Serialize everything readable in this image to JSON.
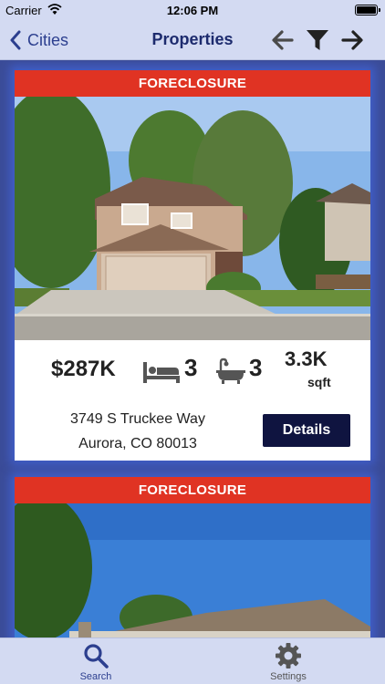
{
  "status_bar": {
    "carrier": "Carrier",
    "time": "12:06 PM"
  },
  "nav": {
    "back_label": "Cities",
    "title": "Properties",
    "icons": [
      "arrow-left-icon",
      "filter-icon",
      "arrow-right-icon"
    ]
  },
  "listings": [
    {
      "banner": "FORECLOSURE",
      "price": "$287K",
      "beds": "3",
      "baths": "3",
      "sqft": "3.3K",
      "sqft_unit": "sqft",
      "address_line1": "3749 S Truckee Way",
      "address_line2": "Aurora, CO 80013",
      "details_label": "Details"
    },
    {
      "banner": "FORECLOSURE"
    }
  ],
  "tab_bar": {
    "search_label": "Search",
    "settings_label": "Settings"
  },
  "colors": {
    "banner": "#e03323",
    "background": "#3b4c98",
    "bar": "#d3daf2",
    "button": "#0f1440",
    "accent": "#2c3f8f"
  }
}
